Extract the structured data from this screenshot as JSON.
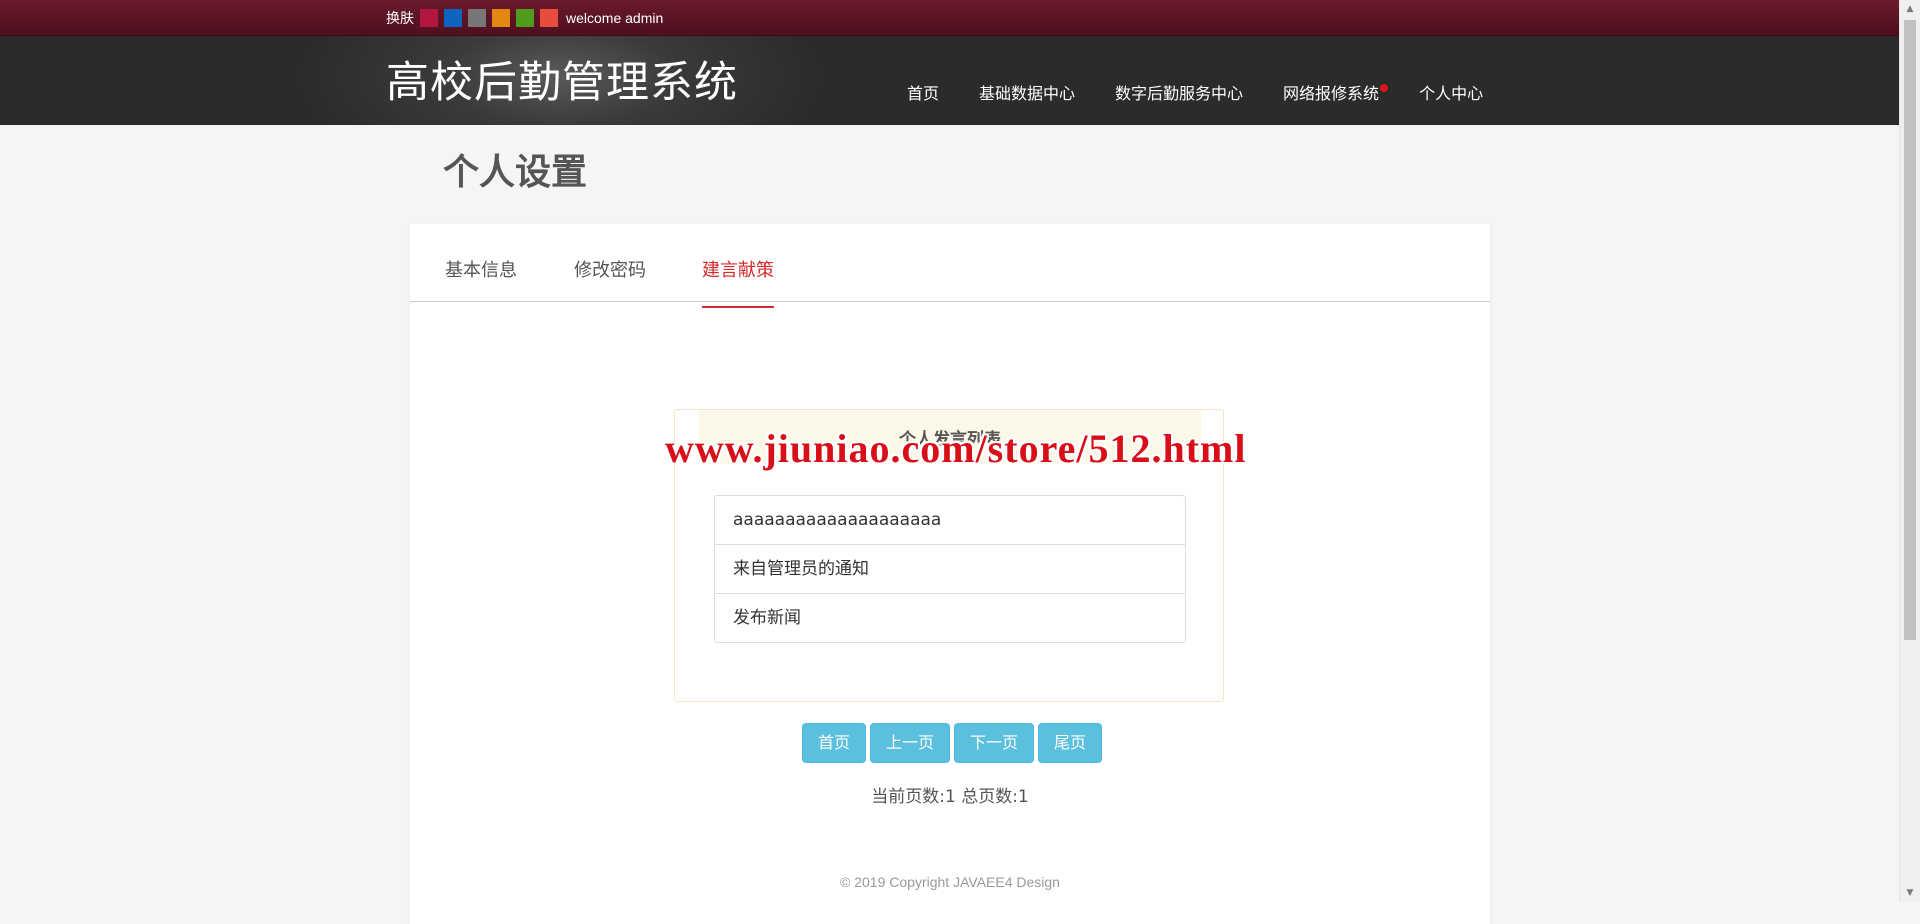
{
  "skinbar": {
    "label": "换肤",
    "swatches": [
      "#b3163f",
      "#0e63bf",
      "#777777",
      "#e2870f",
      "#4f9b1e",
      "#e84c3d"
    ],
    "welcome": "welcome admin"
  },
  "header": {
    "title": "高校后勤管理系统",
    "nav": [
      "首页",
      "基础数据中心",
      "数字后勤服务中心",
      "网络报修系统",
      "个人中心"
    ]
  },
  "page": {
    "heading": "个人设置"
  },
  "tabs": [
    "基本信息",
    "修改密码",
    "建言献策"
  ],
  "active_tab": "建言献策",
  "panel": {
    "title": "个人发言列表",
    "items": [
      "aaaaaaaaaaaaaaaaaaaa",
      "来自管理员的通知",
      "发布新闻"
    ]
  },
  "pager": {
    "first": "首页",
    "prev": "上一页",
    "next": "下一页",
    "last": "尾页",
    "info": "当前页数:1 总页数:1"
  },
  "footer": {
    "copyright": "© 2019 Copyright JAVAEE4 Design"
  },
  "watermark": "www.jiuniao.com/store/512.html"
}
